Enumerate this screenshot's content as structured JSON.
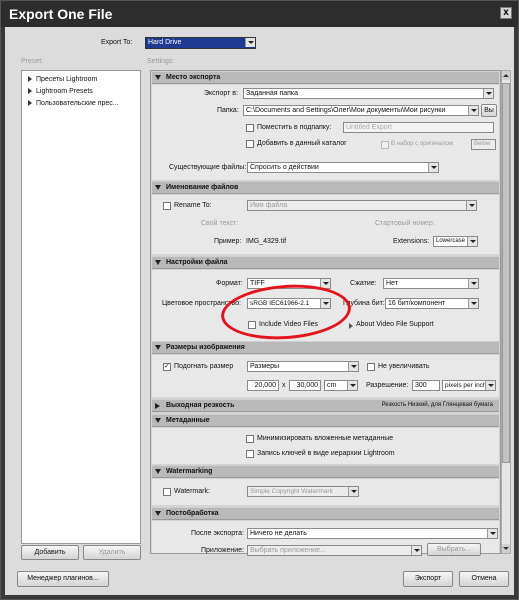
{
  "window": {
    "title": "Export One File",
    "close": "x"
  },
  "export_to": {
    "label": "Export To:",
    "value": "Hard Drive"
  },
  "preset_label": "Preset:",
  "settings_label": "Settings:",
  "presets": [
    "Пресеты Lightroom",
    "Lightroom Presets",
    "Пользовательские прес..."
  ],
  "preset_buttons": {
    "add": "Добавить",
    "remove": "Удалить"
  },
  "sections": {
    "location": {
      "title": "Место экспорта",
      "export_in_label": "Экспорт в:",
      "export_in_value": "Заданная папка",
      "folder_label": "Папка:",
      "folder_value": "C:\\Documents and Settings\\Олег\\Мои документы\\Мои рисунки",
      "browse": "Вы",
      "subfolder_label": "Поместить в подпапку:",
      "subfolder_placeholder": "Untitled Export",
      "add_catalog_label": "Добавить в данный каталог",
      "stack_label": "В набор с оригиналом",
      "below": "Below",
      "existing_label": "Существующие файлы:",
      "existing_value": "Спросить о действии"
    },
    "naming": {
      "title": "Именование файлов",
      "rename_label": "Rename To:",
      "rename_value": "Имя файла",
      "custom_text_label": "Свой текст:",
      "start_number_label": "Стартовый номер:",
      "example_label": "Пример:",
      "example_value": "IMG_4329.tif",
      "extensions_label": "Extensions:",
      "extensions_value": "Lowercase"
    },
    "file": {
      "title": "Настройки файла",
      "format_label": "Формат:",
      "format_value": "TIFF",
      "compression_label": "Сжатие:",
      "compression_value": "Нет",
      "colorspace_label": "Цветовое пространство:",
      "colorspace_value": "sRGB IEC61966-2.1",
      "bitdepth_label": "Глубина бит:",
      "bitdepth_value": "16 бит/компонент",
      "include_video_label": "Include Video Files",
      "about_video": "About Video File Support"
    },
    "sizing": {
      "title": "Размеры изображения",
      "fit_label": "Подогнать размер",
      "fit_value": "Размеры",
      "no_enlarge_label": "Не увеличивать",
      "width": "20,000",
      "times": "x",
      "height": "30,000",
      "unit": "cm",
      "resolution_label": "Разрешение:",
      "resolution_value": "300",
      "resolution_unit": "pixels per inch"
    },
    "sharpening": {
      "title": "Выходная резкость",
      "note": "Резкость Низкий, для Глянцевая бумага"
    },
    "metadata": {
      "title": "Метаданные",
      "minimize_label": "Минимизировать вложенные метаданные",
      "hierarchy_label": "Запись ключей в виде иерархии Lightroom"
    },
    "watermark": {
      "title": "Watermarking",
      "label": "Watermark:",
      "value": "Simple Copyright Watermark"
    },
    "postprocess": {
      "title": "Постобработка",
      "after_label": "После экспорта:",
      "after_value": "Ничего не делать",
      "app_label": "Приложение:",
      "app_value": "Выбрать приложение...",
      "choose": "Выбрать..."
    }
  },
  "footer": {
    "plugin_manager": "Менеджер плагинов...",
    "export": "Экспорт",
    "cancel": "Отмена"
  },
  "colors": {
    "annotation": "#e4141a",
    "section_header": "#b9b9b9",
    "title_bar": "#2d2d2d"
  }
}
